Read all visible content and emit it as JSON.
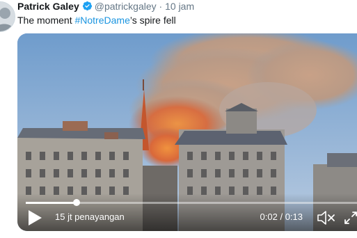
{
  "tweet": {
    "author_name": "Patrick Galey",
    "handle": "@patrickgaley",
    "separator": "·",
    "time": "10 jam",
    "text_before": "The moment ",
    "hashtag": "#NotreDame",
    "text_after": "’s spire fell"
  },
  "video": {
    "view_count": "15 jt penayangan",
    "elapsed": "0:02",
    "time_divider": "/",
    "duration": "0:13",
    "progress_fraction": 0.154
  },
  "icons": {
    "verified": "verified-badge-icon",
    "play": "play-icon",
    "mute": "volume-muted-icon",
    "fullscreen": "fullscreen-icon"
  },
  "colors": {
    "hashtag": "#1b95e0",
    "verified": "#1da1f2",
    "muted_text": "#657786",
    "smoke": "#c9a58a",
    "fire": "#e8702a"
  }
}
